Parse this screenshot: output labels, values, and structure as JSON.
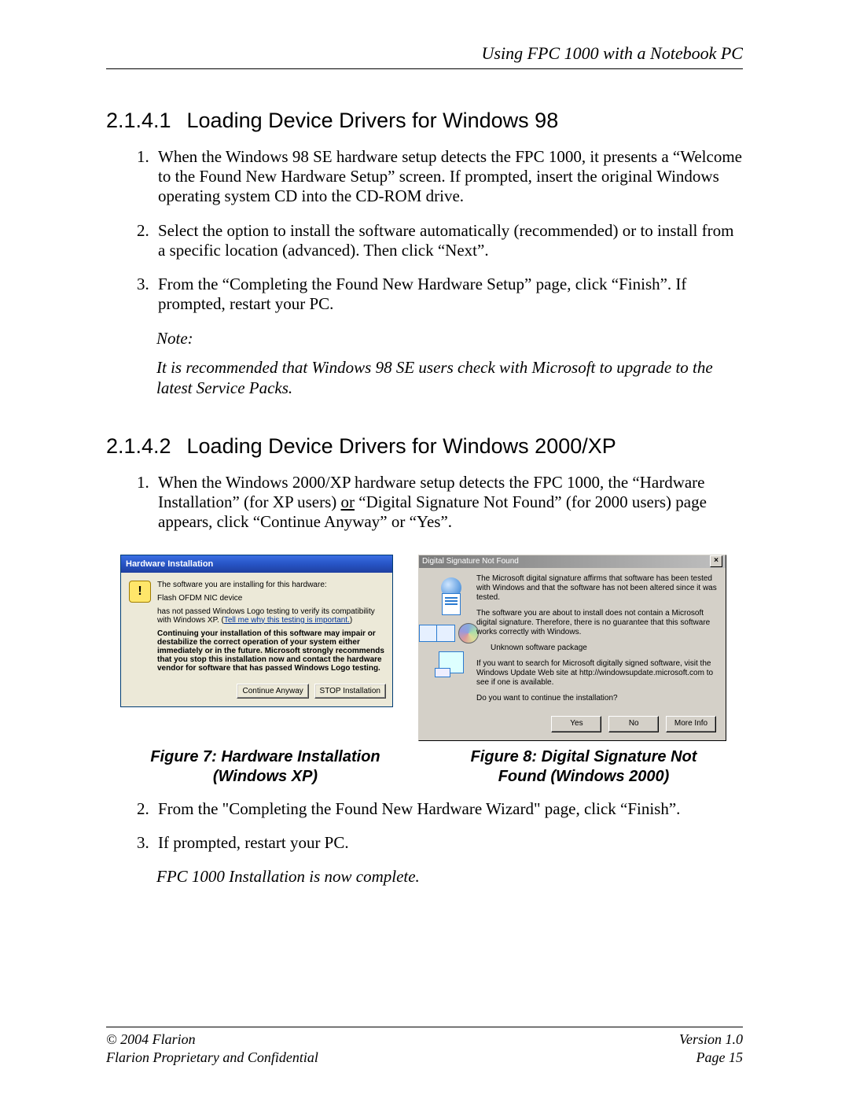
{
  "running_head": "Using FPC 1000 with a Notebook PC",
  "sections": [
    {
      "number": "2.1.4.1",
      "title": "Loading Device Drivers for Windows 98",
      "steps": [
        "When the Windows 98 SE hardware setup detects the FPC 1000, it presents a “Welcome to the Found New Hardware Setup” screen. If prompted, insert the original Windows operating system CD into the CD-ROM drive.",
        "Select the option to install the software automatically (recommended) or to install from a specific location (advanced). Then click “Next”.",
        "From the “Completing the Found New Hardware Setup” page, click “Finish”. If prompted, restart your PC."
      ],
      "note_label": "Note:",
      "note_body": "It is recommended that Windows 98 SE users check with Microsoft to upgrade to the latest Service Packs."
    },
    {
      "number": "2.1.4.2",
      "title": "Loading Device Drivers for Windows 2000/XP",
      "intro_prefix": "When the Windows 2000/XP hardware setup detects the FPC 1000, the “Hardware Installation” (for XP users) ",
      "intro_or": "or",
      "intro_suffix": " “Digital Signature Not Found” (for 2000 users) page appears, click “Continue Anyway” or “Yes”.",
      "later_steps": [
        "From the \"Completing the Found New Hardware Wizard\" page, click “Finish”.",
        "If prompted, restart your PC."
      ],
      "final_italic": "FPC 1000 Installation is now complete."
    }
  ],
  "fig_xp": {
    "title": "Hardware Installation",
    "line1": "The software you are installing for this hardware:",
    "device": "Flash OFDM NIC device",
    "line2a": "has not passed Windows Logo testing to verify its compatibility with Windows XP. (",
    "link": "Tell me why this testing is important.",
    "line2b": ")",
    "warn": "Continuing your installation of this software may impair or destabilize the correct operation of your system either immediately or in the future. Microsoft strongly recommends that you stop this installation now and contact the hardware vendor for software that has passed Windows Logo testing.",
    "btn_continue": "Continue Anyway",
    "btn_stop": "STOP Installation"
  },
  "fig_2k": {
    "title": "Digital Signature Not Found",
    "p1": "The Microsoft digital signature affirms that software has been tested with Windows and that the software has not been altered since it was tested.",
    "p2": "The software you are about to install does not contain a Microsoft digital signature. Therefore, there is no guarantee that this software works correctly with Windows.",
    "pkg": "Unknown software package",
    "p3": "If you want to search for Microsoft digitally signed software, visit the Windows Update Web site at http://windowsupdate.microsoft.com to see if one is available.",
    "p4": "Do you want to continue the installation?",
    "btn_yes": "Yes",
    "btn_no": "No",
    "btn_more": "More Info"
  },
  "captions": {
    "xp_l1": "Figure 7: Hardware Installation",
    "xp_l2": "(Windows XP)",
    "w2k_l1": "Figure 8: Digital Signature Not",
    "w2k_l2": "Found (Windows 2000)"
  },
  "footer": {
    "copyright": "© 2004 Flarion",
    "version": "Version 1.0",
    "prop": "Flarion Proprietary and Confidential",
    "page": "Page 15"
  }
}
